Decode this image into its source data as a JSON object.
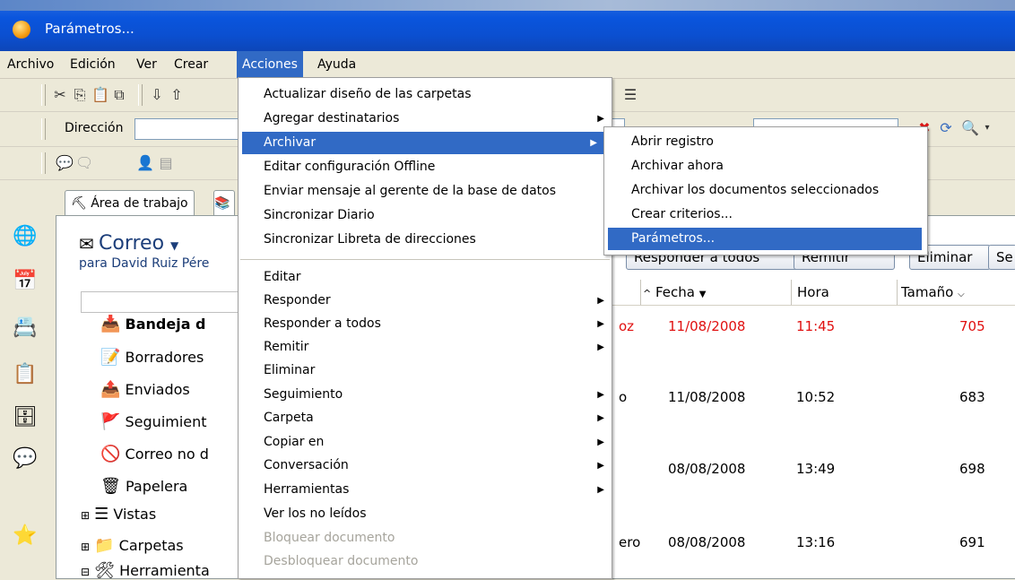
{
  "window": {
    "title": "Parámetros..."
  },
  "menubar": [
    "Archivo",
    "Edición",
    "Ver",
    "Crear",
    "Acciones",
    "Ayuda"
  ],
  "address": {
    "label": "Dirección"
  },
  "tabs": [
    "Área de trabajo"
  ],
  "mail": {
    "title": "Correo",
    "subtitle": "para David Ruiz Pére",
    "folders": [
      "Bandeja d",
      "Borradores",
      "Enviados",
      "Seguimient",
      "Correo no d",
      "Papelera",
      "Vistas",
      "Carpetas",
      "Herramienta"
    ]
  },
  "actions": {
    "responder_todos": "Responder a todos",
    "remitir": "Remitir",
    "eliminar": "Eliminar",
    "se": "Se"
  },
  "columns": {
    "fecha": "Fecha",
    "hora": "Hora",
    "tamano": "Tamaño"
  },
  "rows": [
    {
      "from": "oz",
      "fecha": "11/08/2008",
      "hora": "11:45",
      "tamano": "705",
      "unread": true
    },
    {
      "from": "o",
      "fecha": "11/08/2008",
      "hora": "10:52",
      "tamano": "683",
      "unread": false
    },
    {
      "from": "",
      "fecha": "08/08/2008",
      "hora": "13:49",
      "tamano": "698",
      "unread": false
    },
    {
      "from": "ero",
      "fecha": "08/08/2008",
      "hora": "13:16",
      "tamano": "691",
      "unread": false
    }
  ],
  "acciones_menu": {
    "group1": [
      {
        "label": "Actualizar diseño de las carpetas",
        "submenu": false
      },
      {
        "label": "Agregar destinatarios",
        "submenu": true
      },
      {
        "label": "Archivar",
        "submenu": true,
        "active": true
      },
      {
        "label": "Editar configuración Offline",
        "submenu": false
      },
      {
        "label": "Enviar mensaje al gerente de la base de datos",
        "submenu": false
      },
      {
        "label": "Sincronizar Diario",
        "submenu": false
      },
      {
        "label": "Sincronizar Libreta de direcciones",
        "submenu": false
      }
    ],
    "group2": [
      {
        "label": "Editar",
        "submenu": false
      },
      {
        "label": "Responder",
        "submenu": true
      },
      {
        "label": "Responder a todos",
        "submenu": true
      },
      {
        "label": "Remitir",
        "submenu": true
      },
      {
        "label": "Eliminar",
        "submenu": false
      },
      {
        "label": "Seguimiento",
        "submenu": true
      },
      {
        "label": "Carpeta",
        "submenu": true
      },
      {
        "label": "Copiar en",
        "submenu": true
      },
      {
        "label": "Conversación",
        "submenu": true
      },
      {
        "label": "Herramientas",
        "submenu": true
      },
      {
        "label": "Ver los no leídos",
        "submenu": false
      },
      {
        "label": "Bloquear documento",
        "submenu": false,
        "disabled": true
      },
      {
        "label": "Desbloquear documento",
        "submenu": false,
        "disabled": true
      }
    ]
  },
  "archivar_menu": [
    {
      "label": "Abrir registro"
    },
    {
      "label": "Archivar ahora"
    },
    {
      "label": "Archivar los documentos seleccionados"
    },
    {
      "label": "Crear criterios..."
    },
    {
      "label": "Parámetros...",
      "active": true
    }
  ],
  "colors": {
    "selection": "#316ac5",
    "unread": "#e01010",
    "titlebar": "#0b4fd0"
  }
}
